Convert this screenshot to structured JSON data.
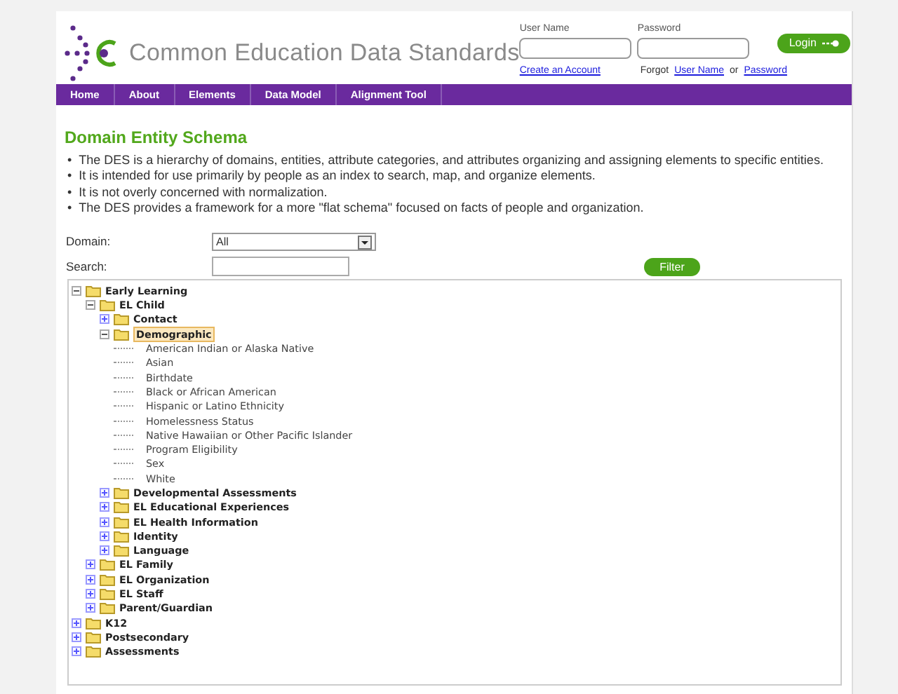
{
  "header": {
    "logo_text": "Common Education Data Standards",
    "login": {
      "username_label": "User Name",
      "password_label": "Password",
      "button": "Login",
      "create_account": "Create an Account",
      "forgot_prefix": "Forgot",
      "forgot_links": [
        "User Name",
        "Password"
      ],
      "forgot_joiner": "or"
    }
  },
  "nav": [
    "Home",
    "About",
    "Elements",
    "Data Model",
    "Alignment Tool"
  ],
  "title": "Domain Entity Schema",
  "bullet_marker": "•",
  "bullets": [
    "The DES is a hierarchy of domains, entities, attribute categories, and attributes organizing and assigning elements to specific entities.",
    "It is intended for use primarily by people as an index to search, map, and organize elements.",
    "It is not overly concerned with normalization.",
    "The DES provides a framework for a more \"flat schema\" focused on facts of people and organization."
  ],
  "filter": {
    "domain_label": "Domain:",
    "domain_value": "All",
    "search_label": "Search:",
    "button": "Filter"
  },
  "tree": [
    {
      "kind": "folder",
      "label": "Early Learning",
      "expanded": true,
      "selected": false,
      "children": [
        {
          "kind": "folder",
          "label": "EL Child",
          "expanded": true,
          "selected": false,
          "children": [
            {
              "kind": "folder",
              "label": "Contact",
              "expanded": false,
              "selected": false
            },
            {
              "kind": "folder",
              "label": "Demographic",
              "expanded": true,
              "selected": true,
              "children": [
                {
                  "kind": "attribute",
                  "label": "American Indian or Alaska Native",
                  "selected": false
                },
                {
                  "kind": "attribute",
                  "label": "Asian",
                  "selected": false
                },
                {
                  "kind": "attribute",
                  "label": "Birthdate",
                  "selected": false
                },
                {
                  "kind": "attribute",
                  "label": "Black or African American",
                  "selected": false
                },
                {
                  "kind": "attribute",
                  "label": "Hispanic or Latino Ethnicity",
                  "selected": false
                },
                {
                  "kind": "attribute",
                  "label": "Homelessness Status",
                  "selected": false
                },
                {
                  "kind": "attribute",
                  "label": "Native Hawaiian or Other Pacific Islander",
                  "selected": false
                },
                {
                  "kind": "attribute",
                  "label": "Program Eligibility",
                  "selected": false
                },
                {
                  "kind": "attribute",
                  "label": "Sex",
                  "selected": false
                },
                {
                  "kind": "attribute",
                  "label": "White",
                  "selected": false
                }
              ]
            },
            {
              "kind": "folder",
              "label": "Developmental Assessments",
              "expanded": false,
              "selected": false
            },
            {
              "kind": "folder",
              "label": "EL Educational Experiences",
              "expanded": false,
              "selected": false
            },
            {
              "kind": "folder",
              "label": "EL Health Information",
              "expanded": false,
              "selected": false
            },
            {
              "kind": "folder",
              "label": "Identity",
              "expanded": false,
              "selected": false
            },
            {
              "kind": "folder",
              "label": "Language",
              "expanded": false,
              "selected": false
            }
          ]
        },
        {
          "kind": "folder",
          "label": "EL Family",
          "expanded": false,
          "selected": false
        },
        {
          "kind": "folder",
          "label": "EL Organization",
          "expanded": false,
          "selected": false
        },
        {
          "kind": "folder",
          "label": "EL Staff",
          "expanded": false,
          "selected": false
        },
        {
          "kind": "folder",
          "label": "Parent/Guardian",
          "expanded": false,
          "selected": false
        }
      ]
    },
    {
      "kind": "folder",
      "label": "K12",
      "expanded": false,
      "selected": false
    },
    {
      "kind": "folder",
      "label": "Postsecondary",
      "expanded": false,
      "selected": false
    },
    {
      "kind": "folder",
      "label": "Assessments",
      "expanded": false,
      "selected": false
    }
  ]
}
